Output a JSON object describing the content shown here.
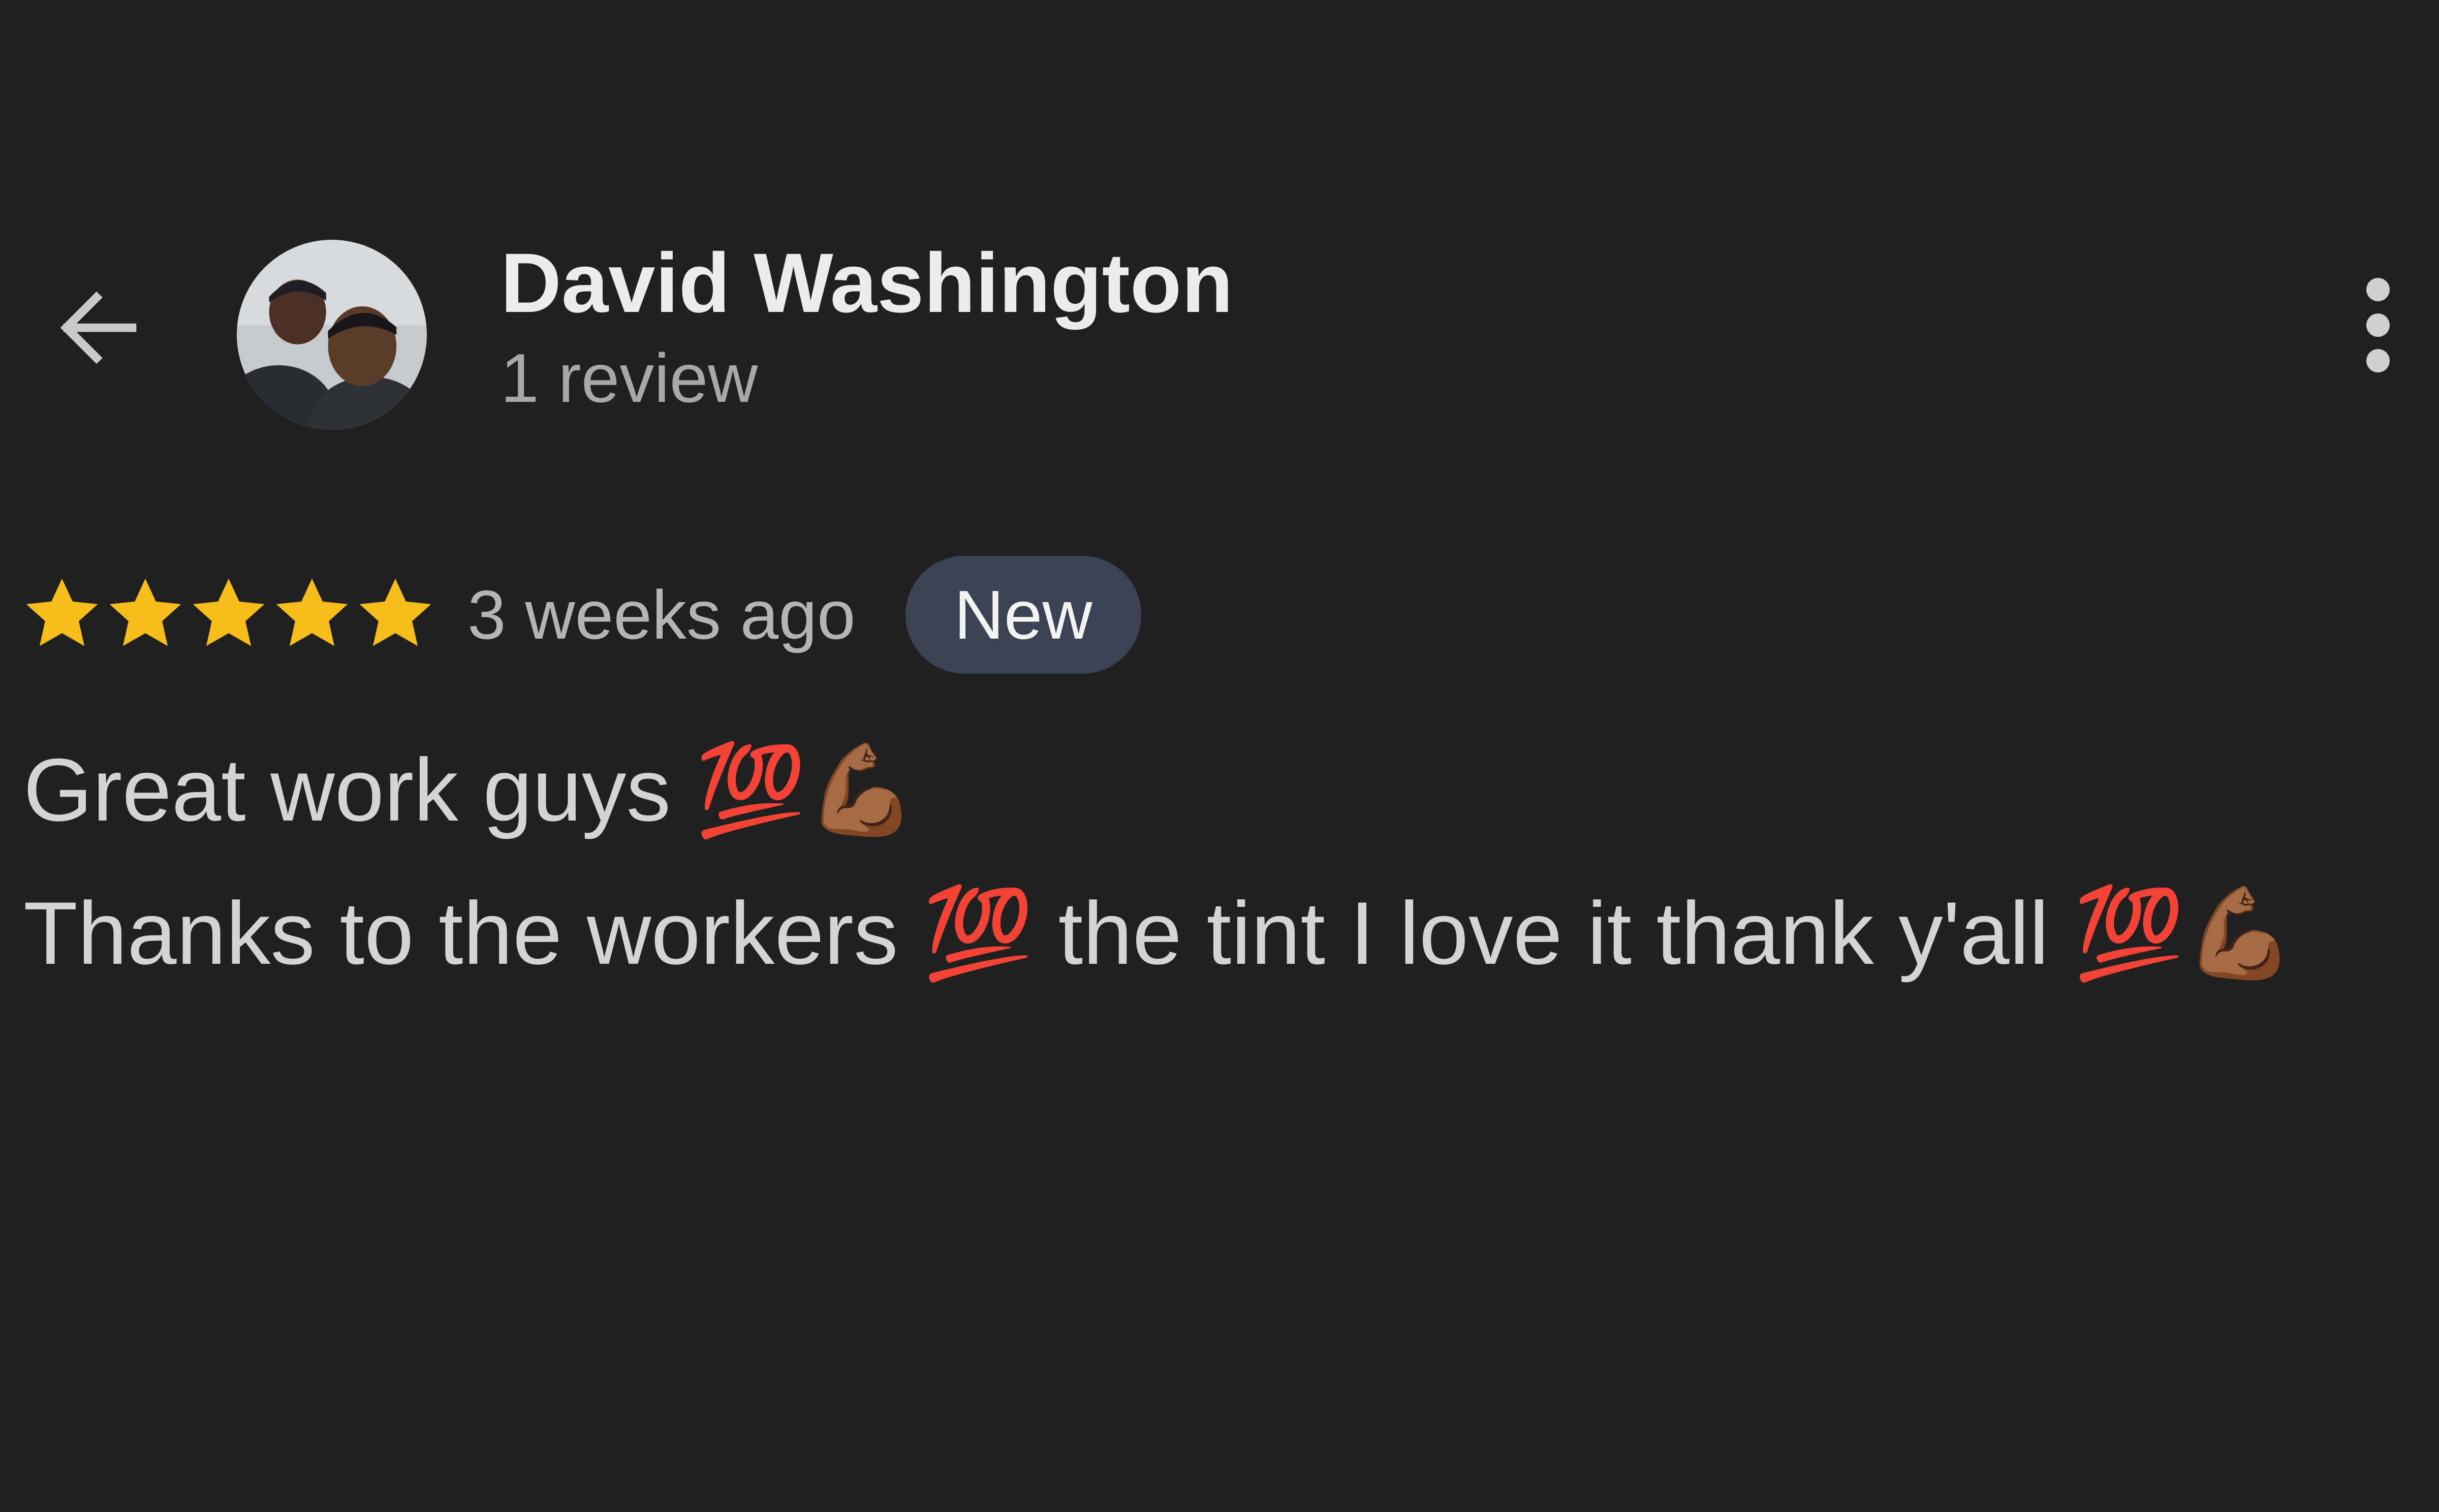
{
  "header": {
    "back_icon": "arrow-back-icon",
    "avatar_icon": "user-photo",
    "user_name": "David Washington",
    "review_count": "1 review",
    "more_icon": "more-vertical-icon"
  },
  "review": {
    "rating": 5,
    "max_rating": 5,
    "star_color": "#f8bd1b",
    "date": "3 weeks ago",
    "badge": "New",
    "text": "Great work guys 💯💪🏾\nThanks to the workers 💯 the tint I love it thank y'all 💯💪🏾"
  },
  "colors": {
    "background": "#202020",
    "badge_background": "#3b4253"
  }
}
